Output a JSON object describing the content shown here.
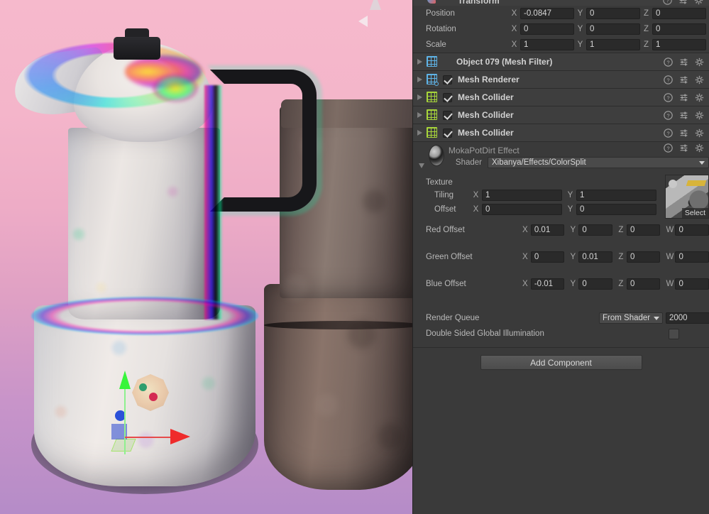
{
  "scene": {
    "name": "scene-view",
    "background_top": "#f6b9cc",
    "background_bottom": "#b58cc8",
    "axis_gizmo_label": "",
    "objects": [
      "moka-pot-color-split",
      "moka-pot-dirty"
    ]
  },
  "inspector": {
    "transform": {
      "title": "Transform",
      "rows": [
        {
          "label": "Position",
          "x": "-0.0847",
          "y": "0",
          "z": "0"
        },
        {
          "label": "Rotation",
          "x": "0",
          "y": "0",
          "z": "0"
        },
        {
          "label": "Scale",
          "x": "1",
          "y": "1",
          "z": "1"
        }
      ],
      "axis_labels": {
        "x": "X",
        "y": "Y",
        "z": "Z",
        "w": "W"
      }
    },
    "components": [
      {
        "name": "Object 079 (Mesh Filter)",
        "icon": "mesh-filter-icon",
        "icon_color": "#5fb4e8",
        "has_checkbox": false,
        "enabled": false,
        "expanded": false
      },
      {
        "name": "Mesh Renderer",
        "icon": "mesh-renderer-icon",
        "icon_color": "#5fb4e8",
        "has_checkbox": true,
        "enabled": true,
        "expanded": false
      },
      {
        "name": "Mesh Collider",
        "icon": "mesh-collider-icon",
        "icon_color": "#a8d63a",
        "has_checkbox": true,
        "enabled": true,
        "expanded": false
      },
      {
        "name": "Mesh Collider",
        "icon": "mesh-collider-icon",
        "icon_color": "#a8d63a",
        "has_checkbox": true,
        "enabled": true,
        "expanded": false
      },
      {
        "name": "Mesh Collider",
        "icon": "mesh-collider-icon",
        "icon_color": "#a8d63a",
        "has_checkbox": true,
        "enabled": true,
        "expanded": false
      }
    ],
    "material": {
      "name": "MokaPotDirt Effect",
      "shader_label": "Shader",
      "shader_value": "Xibanya/Effects/ColorSplit",
      "texture_label": "Texture",
      "texture_select_label": "Select",
      "tiling_label": "Tiling",
      "tiling": {
        "x": "1",
        "y": "1"
      },
      "offset_label": "Offset",
      "offset": {
        "x": "0",
        "y": "0"
      },
      "vectors": [
        {
          "label": "Red Offset",
          "x": "0.01",
          "y": "0",
          "z": "0",
          "w": "0"
        },
        {
          "label": "Green Offset",
          "x": "0",
          "y": "0.01",
          "z": "0",
          "w": "0"
        },
        {
          "label": "Blue Offset",
          "x": "-0.01",
          "y": "0",
          "z": "0",
          "w": "0"
        }
      ],
      "render_queue_label": "Render Queue",
      "render_queue_mode": "From Shader",
      "render_queue_value": "2000",
      "double_sided_label": "Double Sided Global Illumination",
      "double_sided_checked": false
    },
    "add_component_label": "Add Component",
    "icon_names": {
      "help": "help-icon",
      "preset": "preset-icon",
      "settings": "gear-icon"
    }
  }
}
